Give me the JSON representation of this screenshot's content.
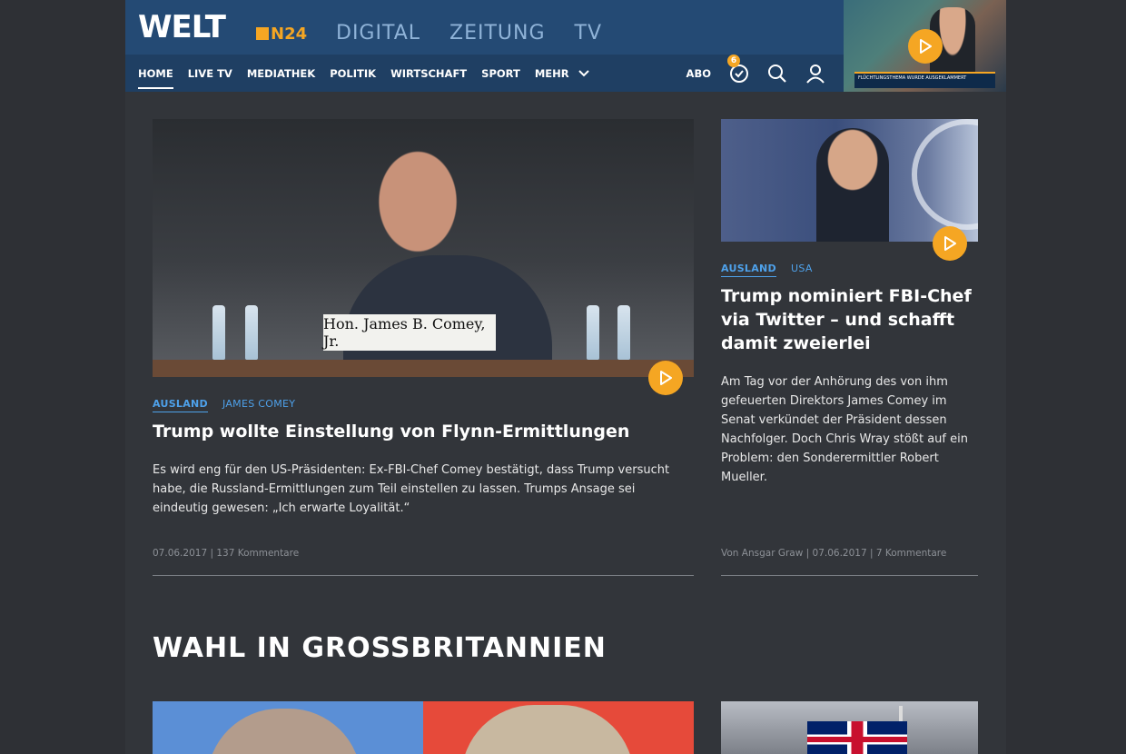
{
  "brand": {
    "logo": "WELT",
    "sub_logo": "N24",
    "sub_brands": [
      "DIGITAL",
      "ZEITUNG",
      "TV"
    ]
  },
  "nav": {
    "items": [
      "HOME",
      "LIVE TV",
      "MEDIATHEK",
      "POLITIK",
      "WIRTSCHAFT",
      "SPORT"
    ],
    "more_label": "MEHR",
    "active": "HOME",
    "abo_label": "ABO",
    "notification_count": "6"
  },
  "live_tv": {
    "ticker_text": "FLÜCHTLINGSTHEMA WURDE AUSGEKLAMMERT"
  },
  "articles": [
    {
      "tag_primary": "AUSLAND",
      "tag_secondary": "JAMES COMEY",
      "image_caption": "Hon. James B. Comey, Jr.",
      "headline": "Trump wollte Einstellung von Flynn-Ermittlungen",
      "teaser": "Es wird eng für den US-Präsidenten: Ex-FBI-Chef Comey bestätigt, dass Trump versucht habe, die Russland-Ermittlungen zum Teil einstellen zu lassen. Trumps Ansage sei eindeutig gewesen: „Ich erwarte Loyalität.“",
      "meta": "07.06.2017  |  137 Kommentare"
    },
    {
      "tag_primary": "AUSLAND",
      "tag_secondary": "USA",
      "headline": "Trump nominiert FBI-Chef via Twitter – und schafft damit zweierlei",
      "teaser": "Am Tag vor der Anhörung des von ihm gefeuerten Direktors James Comey im Senat verkündet der Präsident dessen Nachfolger. Doch Chris Wray stößt auf ein Problem: den Sonderermittler Robert Mueller.",
      "meta": "Von Ansgar Graw  |  07.06.2017  |  7 Kommentare"
    }
  ],
  "section": {
    "title": "WAHL IN GROSSBRITANNIEN"
  },
  "colors": {
    "accent": "#f5a623",
    "tag": "#4ea1ea",
    "header": "#1f3f63",
    "background": "#32353a"
  }
}
